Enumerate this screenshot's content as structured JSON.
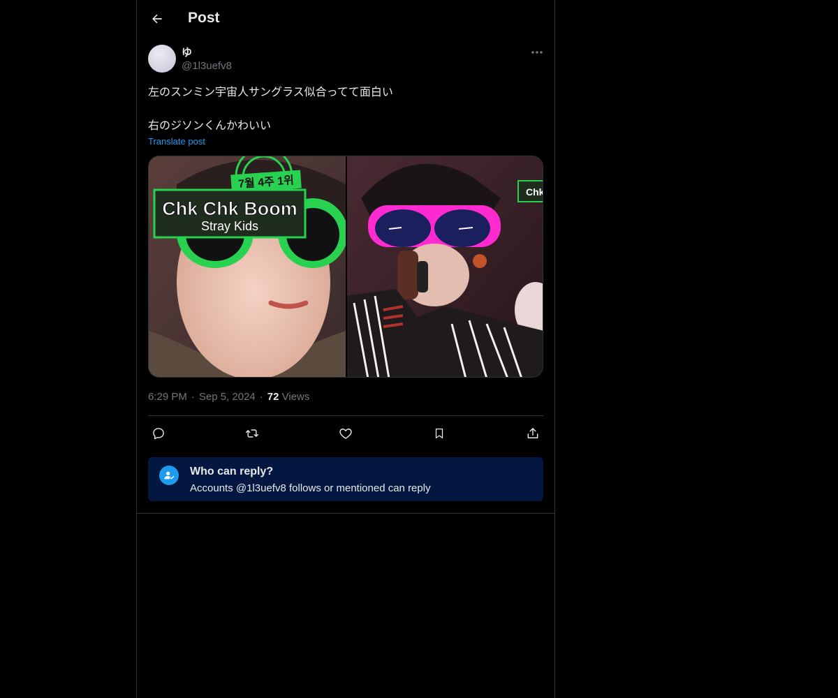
{
  "header": {
    "title": "Post"
  },
  "post": {
    "display_name": "ゆ",
    "handle": "@1l3uefv8",
    "text_line1": "左のスンミン宇宙人サングラス似合ってて面白い",
    "text_line2": "右のジソンくんかわいい",
    "translate_label": "Translate post",
    "media": [
      {
        "overlay_small": "7월 4주 1위",
        "overlay_title": "Chk Chk Boom",
        "overlay_sub": "Stray Kids"
      },
      {
        "overlay_small": "Chk"
      }
    ],
    "time": "6:29 PM",
    "date": "Sep 5, 2024",
    "views_count": "72",
    "views_label": "Views"
  },
  "actions": [
    "reply-icon",
    "retweet-icon",
    "like-icon",
    "bookmark-icon",
    "share-icon"
  ],
  "who_can_reply": {
    "title": "Who can reply?",
    "subtitle": "Accounts @1l3uefv8 follows or mentioned can reply"
  },
  "colors": {
    "background": "#000000",
    "text": "#e7e9ea",
    "muted": "#71767b",
    "accent": "#1d9bf0",
    "reply_box": "#031740"
  }
}
